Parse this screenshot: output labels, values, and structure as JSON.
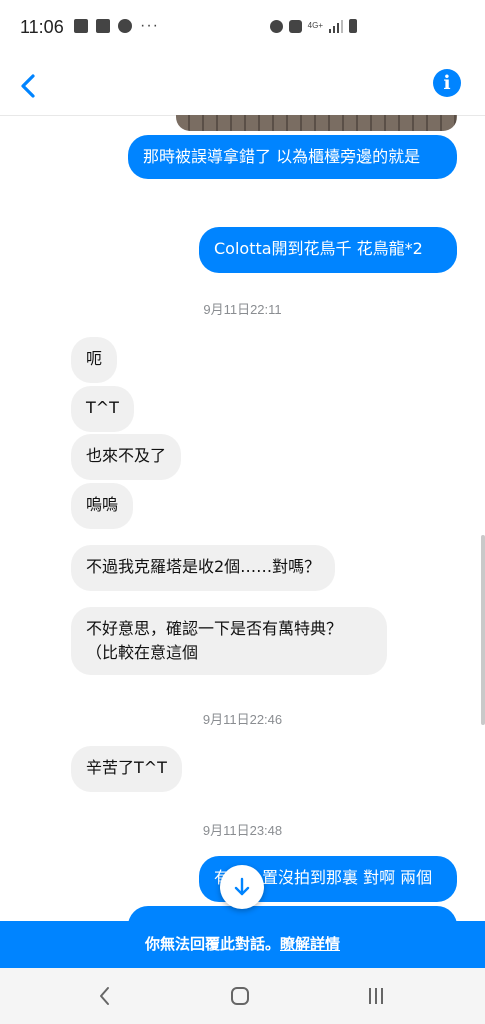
{
  "status_bar": {
    "time": "11:06",
    "left_icons": [
      "image-icon",
      "notes-icon",
      "soccer-ball-icon"
    ],
    "overflow": "···",
    "right_icons": [
      "alarm-icon",
      "mute-icon",
      "signal-icon",
      "battery-icon"
    ],
    "network": "4G+"
  },
  "header": {
    "back_icon": "chevron-left-icon",
    "info_icon": "info-icon",
    "info_label": "i"
  },
  "messages": [
    {
      "dir": "out",
      "text": "那時被誤導拿錯了 以為櫃檯旁邊的就是"
    },
    {
      "dir": "out",
      "text": "Colotta開到花鳥千 花鳥龍*2"
    },
    {
      "dir": "time",
      "text": "9月11日22:11"
    },
    {
      "dir": "in",
      "text": "呃"
    },
    {
      "dir": "in",
      "text": "T^T"
    },
    {
      "dir": "in",
      "text": "也來不及了"
    },
    {
      "dir": "in",
      "text": "嗚嗚"
    },
    {
      "dir": "in",
      "text": "不過我克羅塔是收2個……對嗎？"
    },
    {
      "dir": "in",
      "text": "不好意思，確認一下是否有萬特典？（比較在意這個"
    },
    {
      "dir": "time",
      "text": "9月11日22:46"
    },
    {
      "dir": "in",
      "text": "辛苦了T^T"
    },
    {
      "dir": "time",
      "text": "9月11日23:48"
    },
    {
      "dir": "out",
      "text": "有　　置沒拍到那裏 對啊 兩個"
    }
  ],
  "scroll_down_icon": "arrow-down-icon",
  "banner": {
    "text": "你無法回覆此對話。",
    "link": "瞭解詳情"
  },
  "nav_bar": {
    "back_icon": "nav-back-icon",
    "home_icon": "nav-home-icon",
    "recents_icon": "nav-recents-icon"
  },
  "colors": {
    "accent": "#0084ff",
    "incoming_bubble": "#f0f0f0",
    "timestamp": "#8a8d91"
  }
}
